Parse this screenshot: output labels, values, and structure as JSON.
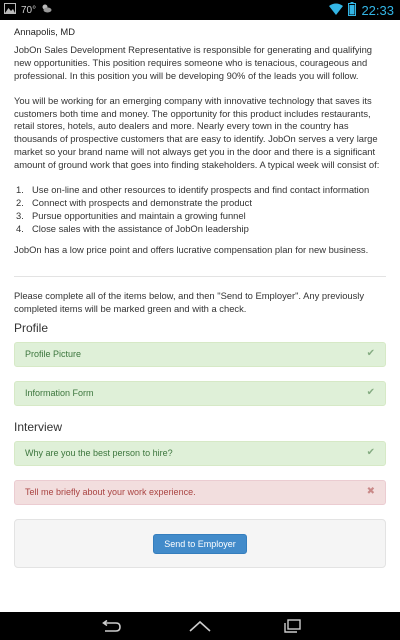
{
  "status_bar": {
    "temperature": "70°",
    "time": "22:33",
    "icons": [
      "image-icon",
      "weather-icon",
      "wifi-icon",
      "battery-icon"
    ]
  },
  "job": {
    "location": "Annapolis, MD",
    "intro": "JobOn Sales Development Representative is responsible for generating and qualifying new opportunities.  This position requires someone who is tenacious, courageous and professional.  In this position you will be developing 90% of the leads you will follow.",
    "description": "You will be working for an emerging company with innovative technology that saves its customers both time and money.  The opportunity for this product includes restaurants, retail stores, hotels, auto dealers and more.  Nearly every town in the country has thousands of prospective customers that are easy to identify.  JobOn serves a very large market so your brand name will not always get you in the door and there is a significant amount of ground work that goes into finding stakeholders.  A typical week will consist of:",
    "duties": [
      {
        "num": "1.",
        "text": "Use on-line and other resources to identify prospects and find contact information"
      },
      {
        "num": "2.",
        "text": "Connect with prospects and demonstrate the product"
      },
      {
        "num": "3.",
        "text": "Pursue opportunities and maintain a growing funnel"
      },
      {
        "num": "4.",
        "text": "Close sales with the assistance of JobOn leadership"
      }
    ],
    "compensation": "JobOn has a low price point and offers lucrative compensation plan for new business."
  },
  "instructions": "Please complete all of the items below, and then \"Send to Employer\". Any previously completed items will be marked green and with a check.",
  "profile": {
    "title": "Profile",
    "items": [
      {
        "label": "Profile Picture",
        "mark": "✔"
      },
      {
        "label": "Information Form",
        "mark": "✔"
      }
    ]
  },
  "interview": {
    "title": "Interview",
    "items": [
      {
        "label": "Why are you the best person to hire?",
        "mark": "✔"
      },
      {
        "label": "Tell me briefly about your work experience.",
        "mark": "✖"
      }
    ]
  },
  "send_button": "Send to Employer",
  "colors": {
    "complete_bg": "#dff0d8",
    "complete_text": "#3c763d",
    "incomplete_bg": "#f2dede",
    "incomplete_text": "#a94442",
    "primary_button": "#428bca",
    "clock": "#33b5e5"
  }
}
